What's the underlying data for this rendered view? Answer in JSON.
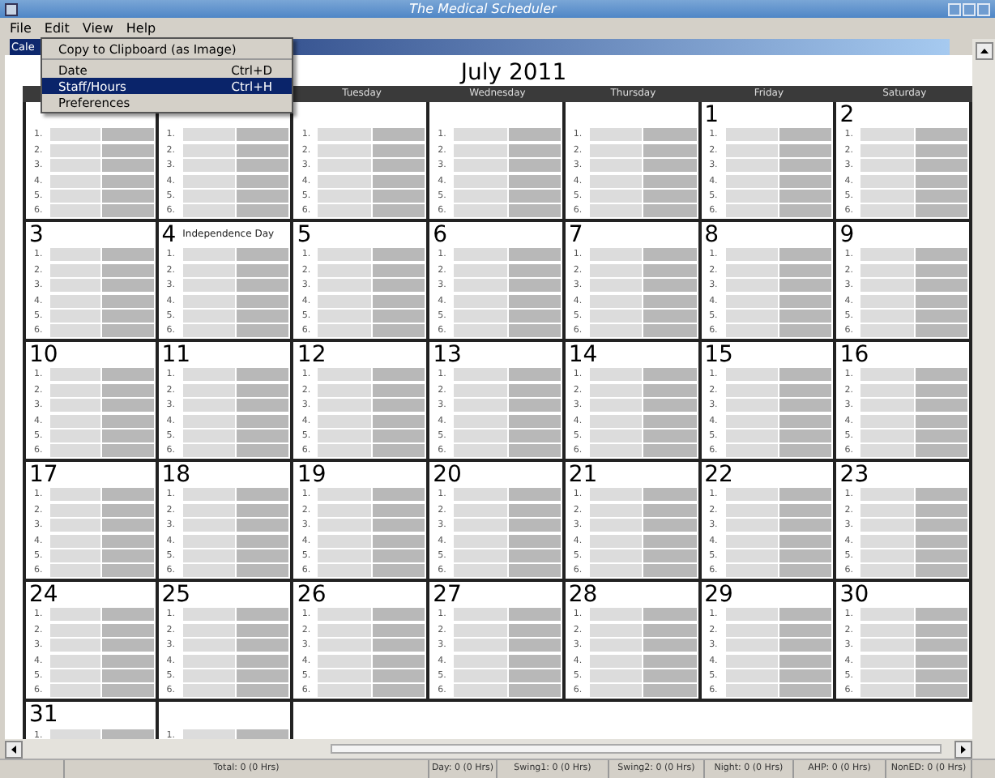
{
  "window": {
    "title": "The Medical Scheduler"
  },
  "menus": [
    {
      "label": "File"
    },
    {
      "label": "Edit"
    },
    {
      "label": "View"
    },
    {
      "label": "Help"
    }
  ],
  "open_menu": {
    "items": [
      {
        "kind": "item",
        "label": "Copy to Clipboard (as Image)",
        "selected": false
      },
      {
        "kind": "separator"
      },
      {
        "kind": "item",
        "label": "Date",
        "shortcut": "Ctrl+D",
        "selected": false
      },
      {
        "kind": "item",
        "label": "Staff/Hours",
        "shortcut": "Ctrl+H",
        "selected": true
      },
      {
        "kind": "item",
        "label": "Preferences",
        "selected": false
      }
    ]
  },
  "tab": {
    "label": "Cale"
  },
  "calendar": {
    "title": "July 2011",
    "weekdays": [
      "Tuesday",
      "Wednesday",
      "Thursday",
      "Friday",
      "Saturday"
    ],
    "weeks": [
      [
        {
          "slots": [
            "1.",
            "2.",
            "3.",
            "4.",
            "5.",
            "6."
          ]
        },
        {
          "slots": [
            "1.",
            "2.",
            "3.",
            "4.",
            "5.",
            "6."
          ]
        },
        {
          "slots": [
            "1.",
            "2.",
            "3.",
            "4.",
            "5.",
            "6."
          ]
        },
        {
          "slots": [
            "1.",
            "2.",
            "3.",
            "4.",
            "5.",
            "6."
          ]
        },
        {
          "slots": [
            "1.",
            "2.",
            "3.",
            "4.",
            "5.",
            "6."
          ]
        },
        {
          "day": "1",
          "slots": [
            "1.",
            "2.",
            "3.",
            "4.",
            "5.",
            "6."
          ]
        },
        {
          "day": "2",
          "slots": [
            "1.",
            "2.",
            "3.",
            "4.",
            "5.",
            "6."
          ]
        }
      ],
      [
        {
          "day": "3",
          "slots": [
            "1.",
            "2.",
            "3.",
            "4.",
            "5.",
            "6."
          ]
        },
        {
          "day": "4",
          "note": "Independence Day",
          "slots": [
            "1.",
            "2.",
            "3.",
            "4.",
            "5.",
            "6."
          ]
        },
        {
          "day": "5",
          "slots": [
            "1.",
            "2.",
            "3.",
            "4.",
            "5.",
            "6."
          ]
        },
        {
          "day": "6",
          "slots": [
            "1.",
            "2.",
            "3.",
            "4.",
            "5.",
            "6."
          ]
        },
        {
          "day": "7",
          "slots": [
            "1.",
            "2.",
            "3.",
            "4.",
            "5.",
            "6."
          ]
        },
        {
          "day": "8",
          "slots": [
            "1.",
            "2.",
            "3.",
            "4.",
            "5.",
            "6."
          ]
        },
        {
          "day": "9",
          "slots": [
            "1.",
            "2.",
            "3.",
            "4.",
            "5.",
            "6."
          ]
        }
      ],
      [
        {
          "day": "10",
          "slots": [
            "1.",
            "2.",
            "3.",
            "4.",
            "5.",
            "6."
          ]
        },
        {
          "day": "11",
          "slots": [
            "1.",
            "2.",
            "3.",
            "4.",
            "5.",
            "6."
          ]
        },
        {
          "day": "12",
          "slots": [
            "1.",
            "2.",
            "3.",
            "4.",
            "5.",
            "6."
          ]
        },
        {
          "day": "13",
          "slots": [
            "1.",
            "2.",
            "3.",
            "4.",
            "5.",
            "6."
          ]
        },
        {
          "day": "14",
          "slots": [
            "1.",
            "2.",
            "3.",
            "4.",
            "5.",
            "6."
          ]
        },
        {
          "day": "15",
          "slots": [
            "1.",
            "2.",
            "3.",
            "4.",
            "5.",
            "6."
          ]
        },
        {
          "day": "16",
          "slots": [
            "1.",
            "2.",
            "3.",
            "4.",
            "5.",
            "6."
          ]
        }
      ],
      [
        {
          "day": "17",
          "slots": [
            "1.",
            "2.",
            "3.",
            "4.",
            "5.",
            "6."
          ]
        },
        {
          "day": "18",
          "slots": [
            "1.",
            "2.",
            "3.",
            "4.",
            "5.",
            "6."
          ]
        },
        {
          "day": "19",
          "slots": [
            "1.",
            "2.",
            "3.",
            "4.",
            "5.",
            "6."
          ]
        },
        {
          "day": "20",
          "slots": [
            "1.",
            "2.",
            "3.",
            "4.",
            "5.",
            "6."
          ]
        },
        {
          "day": "21",
          "slots": [
            "1.",
            "2.",
            "3.",
            "4.",
            "5.",
            "6."
          ]
        },
        {
          "day": "22",
          "slots": [
            "1.",
            "2.",
            "3.",
            "4.",
            "5.",
            "6."
          ]
        },
        {
          "day": "23",
          "slots": [
            "1.",
            "2.",
            "3.",
            "4.",
            "5.",
            "6."
          ]
        }
      ],
      [
        {
          "day": "24",
          "slots": [
            "1.",
            "2.",
            "3.",
            "4.",
            "5.",
            "6."
          ]
        },
        {
          "day": "25",
          "slots": [
            "1.",
            "2.",
            "3.",
            "4.",
            "5.",
            "6."
          ]
        },
        {
          "day": "26",
          "slots": [
            "1.",
            "2.",
            "3.",
            "4.",
            "5.",
            "6."
          ]
        },
        {
          "day": "27",
          "slots": [
            "1.",
            "2.",
            "3.",
            "4.",
            "5.",
            "6."
          ]
        },
        {
          "day": "28",
          "slots": [
            "1.",
            "2.",
            "3.",
            "4.",
            "5.",
            "6."
          ]
        },
        {
          "day": "29",
          "slots": [
            "1.",
            "2.",
            "3.",
            "4.",
            "5.",
            "6."
          ]
        },
        {
          "day": "30",
          "slots": [
            "1.",
            "2.",
            "3.",
            "4.",
            "5.",
            "6."
          ]
        }
      ],
      [
        {
          "day": "31",
          "slots": [
            "1."
          ]
        },
        {
          "slots": [
            "1."
          ]
        }
      ]
    ]
  },
  "status_bar": [
    "Total: 0 (0 Hrs)",
    "Day: 0 (0 Hrs)",
    "Swing1: 0 (0 Hrs)",
    "Swing2: 0 (0 Hrs)",
    "Night: 0 (0 Hrs)",
    "AHP: 0 (0 Hrs)",
    "NonED: 0 (0 Hrs)"
  ]
}
